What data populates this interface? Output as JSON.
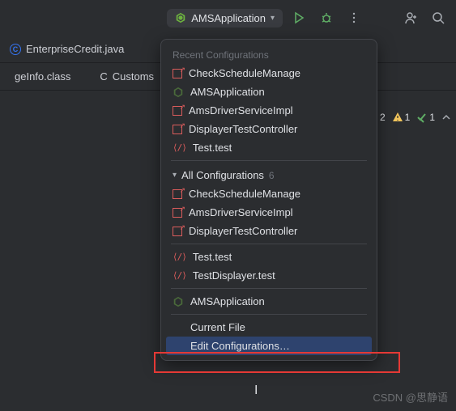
{
  "topbar": {
    "run_config": "AMSApplication"
  },
  "tabs": {
    "t1": "EnterpriseCredit.java",
    "t2": "geInfo.class",
    "t3": "Customs"
  },
  "status": {
    "errors": "2",
    "warnings": "1",
    "ok": "1"
  },
  "popup": {
    "recent_header": "Recent Configurations",
    "all_header": "All Configurations",
    "all_count": "6",
    "items": {
      "checkschedule": "CheckScheduleManage",
      "amsapp": "AMSApplication",
      "amsdriver": "AmsDriverServiceImpl",
      "displayer": "DisplayerTestController",
      "testtest": "Test.test",
      "testdisplayer": "TestDisplayer.test",
      "currentfile": "Current File",
      "editconfig": "Edit Configurations…"
    }
  },
  "watermark": "CSDN @思静语"
}
